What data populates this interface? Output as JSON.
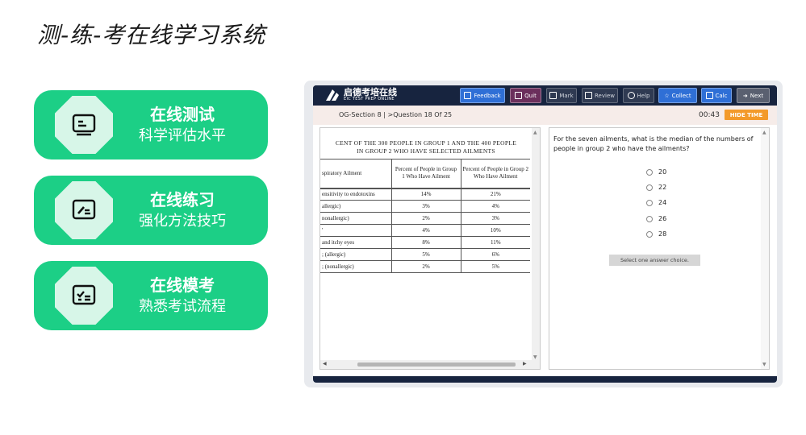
{
  "page": {
    "title": "测-练-考在线学习系统"
  },
  "features": [
    {
      "title": "在线测试",
      "subtitle": "科学评估水平",
      "icon": "monitor-icon"
    },
    {
      "title": "在线练习",
      "subtitle": "强化方法技巧",
      "icon": "pen-board-icon"
    },
    {
      "title": "在线模考",
      "subtitle": "熟悉考试流程",
      "icon": "checklist-board-icon"
    }
  ],
  "app": {
    "logo": {
      "cn": "启德考培在线",
      "en": "EIC TEST PREP ONLINE"
    },
    "toolbar": {
      "feedback": "Feedback",
      "quit": "Quit",
      "mark": "Mark",
      "review": "Review",
      "help": "Help",
      "collect": "Collect",
      "calc": "Calc",
      "next": "Next"
    },
    "status": {
      "section": "OG-Section 8",
      "separator": "|",
      "question": ">Question 18 Of 25",
      "timer": "00:43",
      "hide_time": "HIDE TIME"
    },
    "passage": {
      "caption_line1": "CENT OF THE 300 PEOPLE IN GROUP 1 AND THE 400 PEOPLE",
      "caption_line2": "IN GROUP 2 WHO HAVE SELECTED AILMENTS",
      "headers": [
        "spiratory Ailment",
        "Percent of People in Group 1 Who Have Ailment",
        "Percent of People in Group 2 Who Have Ailment"
      ],
      "rows": [
        [
          "ensitivity to endotoxins",
          "14%",
          "21%"
        ],
        [
          "allergic)",
          "3%",
          "4%"
        ],
        [
          "nonallergic)",
          "2%",
          "3%"
        ],
        [
          "'",
          "4%",
          "10%"
        ],
        [
          " and itchy eyes",
          "8%",
          "11%"
        ],
        [
          "; (allergic)",
          "5%",
          "6%"
        ],
        [
          "; (nonallergic)",
          "2%",
          "5%"
        ]
      ]
    },
    "question": {
      "text": "For the seven ailments, what is the median of the numbers of people in group 2 who have the ailments?",
      "choices": [
        "20",
        "22",
        "24",
        "26",
        "28"
      ],
      "instruction": "Select one answer choice."
    }
  }
}
